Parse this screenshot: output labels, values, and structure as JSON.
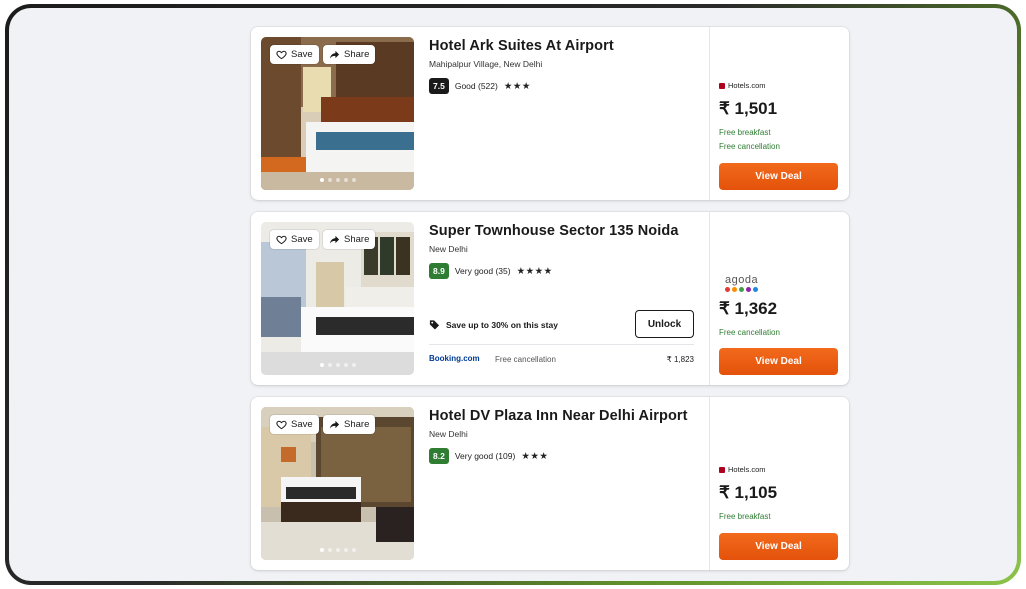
{
  "colors": {
    "deal_button": "#ec5d12",
    "score_dark": "#1a1a1a",
    "score_green": "#2e7d32",
    "perk_green": "#2e7d32",
    "booking_blue": "#003b95"
  },
  "actions": {
    "save_label": "Save",
    "share_label": "Share"
  },
  "hotels": [
    {
      "name": "Hotel Ark Suites At Airport",
      "location": "Mahipalpur Village, New Delhi",
      "score": "7.5",
      "rating_text": "Good (522)",
      "stars": "★★★",
      "provider": "Hotels.com",
      "price": "₹ 1,501",
      "perks": [
        "Free breakfast",
        "Free cancellation"
      ],
      "deal_label": "View Deal",
      "photo_page": "1 of 5"
    },
    {
      "name": "Super Townhouse Sector 135 Noida",
      "location": "New Delhi",
      "score": "8.9",
      "rating_text": "Very good (35)",
      "stars": "★★★★",
      "provider": "agoda",
      "price": "₹ 1,362",
      "perks": [
        "Free cancellation"
      ],
      "deal_label": "View Deal",
      "promo_text": "Save up to 30% on this stay",
      "unlock_label": "Unlock",
      "alt_provider": "Booking.com",
      "alt_perk": "Free cancellation",
      "alt_price": "₹ 1,823",
      "photo_page": "1 of 5"
    },
    {
      "name": "Hotel DV Plaza Inn Near Delhi Airport",
      "location": "New Delhi",
      "score": "8.2",
      "rating_text": "Very good (109)",
      "stars": "★★★",
      "provider": "Hotels.com",
      "price": "₹ 1,105",
      "perks": [
        "Free breakfast"
      ],
      "deal_label": "View Deal",
      "photo_page": "1 of 5"
    }
  ]
}
